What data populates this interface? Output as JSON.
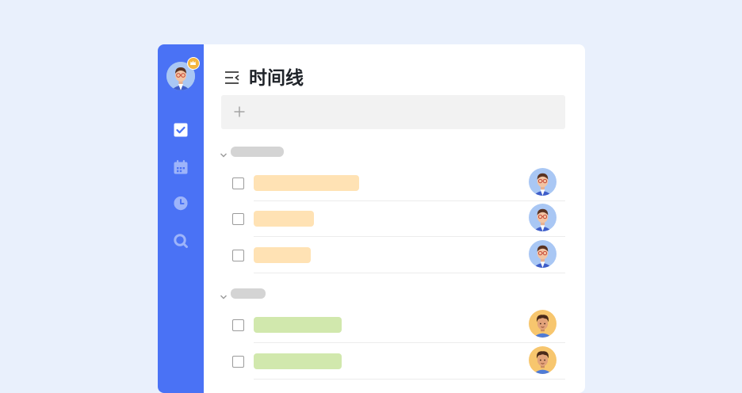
{
  "app": {
    "title": "时间线"
  },
  "colors": {
    "background": "#e9f0fc",
    "sidebar": "#4a72f5",
    "accent_orange": "#ffe2b4",
    "accent_green": "#d1e8ad",
    "crown": "#f4b63f"
  },
  "sidebar": {
    "items": [
      {
        "icon": "checkbox-icon",
        "active": true
      },
      {
        "icon": "calendar-icon",
        "active": false
      },
      {
        "icon": "clock-icon",
        "active": false
      },
      {
        "icon": "search-icon",
        "active": false
      }
    ]
  },
  "groups": [
    {
      "expanded": true,
      "tasks": [
        {
          "pill_color": "#ffe2b4",
          "avatar": "male-glasses"
        },
        {
          "pill_color": "#ffe2b4",
          "avatar": "male-glasses"
        },
        {
          "pill_color": "#ffe2b4",
          "avatar": "male-glasses"
        }
      ]
    },
    {
      "expanded": true,
      "tasks": [
        {
          "pill_color": "#d1e8ad",
          "avatar": "male-curly"
        },
        {
          "pill_color": "#d1e8ad",
          "avatar": "male-curly"
        }
      ]
    }
  ]
}
